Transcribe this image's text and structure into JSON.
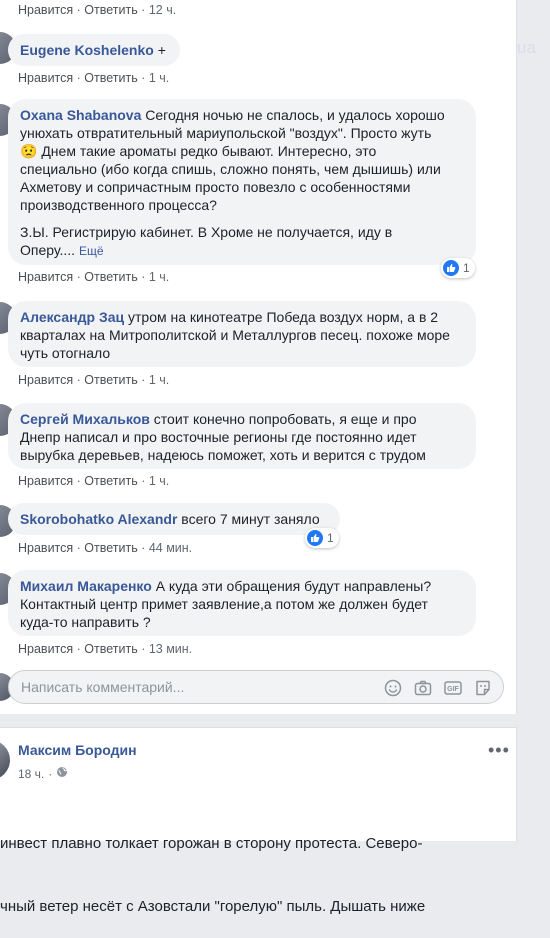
{
  "top_fragment": {
    "like": "Нравится",
    "reply": "Ответить",
    "time": "12 ч."
  },
  "comments": [
    {
      "id": "koshelenko",
      "author": "Eugene Koshelenko",
      "suffix": "+",
      "like": "Нравится",
      "reply": "Ответить",
      "time": "1 ч."
    },
    {
      "id": "shabanova",
      "author": "Oxana Shabanova",
      "text_lines": [
        "Сегодня ночью не спалось, и удалось хорошо",
        "унюхать отвратительный мариупольской \"воздух\". Просто жуть",
        "😟 Днем такие ароматы редко бывают. Интересно, это",
        "специально (ибо когда спишь, сложно понять, чем дышишь) или",
        "Ахметову и сопричастным просто повезло с особенностями",
        "производственного процесса?"
      ],
      "text2_lines": [
        "З.Ы. Регистрирую кабинет. В Хроме не получается, иду в",
        "Оперу...."
      ],
      "more": "Ещё",
      "like": "Нравится",
      "reply": "Ответить",
      "time": "1 ч.",
      "reactions": "1"
    },
    {
      "id": "zats",
      "author": "Александр Зац",
      "text_lines": [
        "утром на кинотеатре Победа воздух норм, а в 2",
        "кварталах на Митрополитской и Металлургов песец. похоже море",
        "чуть отогнало"
      ],
      "like": "Нравится",
      "reply": "Ответить",
      "time": "1 ч."
    },
    {
      "id": "mikhalkov",
      "author": "Сергей Михальков",
      "text_lines": [
        "стоит конечно попробовать, я еще и про",
        "Днепр написал и про восточные регионы где постоянно идет",
        "вырубка деревьев, надеюсь поможет, хоть и верится с трудом"
      ],
      "like": "Нравится",
      "reply": "Ответить",
      "time": "1 ч."
    },
    {
      "id": "skorobohatko",
      "author": "Skorobohatko Alexandr",
      "text_lines": [
        "всего 7 минут заняло"
      ],
      "like": "Нравится",
      "reply": "Ответить",
      "time": "44 мин.",
      "reactions": "1"
    },
    {
      "id": "makarenko",
      "author": "Михаил Макаренко",
      "text_lines": [
        "А куда эти обращения будут направлены?",
        "Контактный центр примет заявление,а потом же должен будет",
        "куда-то направить ?"
      ],
      "like": "Нравится",
      "reply": "Ответить",
      "time": "13 мин."
    }
  ],
  "composer": {
    "placeholder": "Написать комментарий...",
    "icons": [
      "emoji-icon",
      "camera-icon",
      "gif-icon",
      "sticker-icon"
    ]
  },
  "post": {
    "author": "Максим Бородин",
    "time": "18 ч.",
    "privacy_icon": "globe-icon",
    "menu_icon": "more-dots-icon",
    "text_lines": [
      "инвест плавно толкает горожан в сторону протеста. Северо-",
      "чный ветер несёт с Азовстали \"горелую\" пыль. Дышать ниже"
    ]
  },
  "watermark": "ua",
  "colors": {
    "link": "#385898",
    "meta": "#606770",
    "bubble": "#f2f3f5",
    "like_blue": "#2078f4",
    "page_bg": "#e9ebee"
  }
}
